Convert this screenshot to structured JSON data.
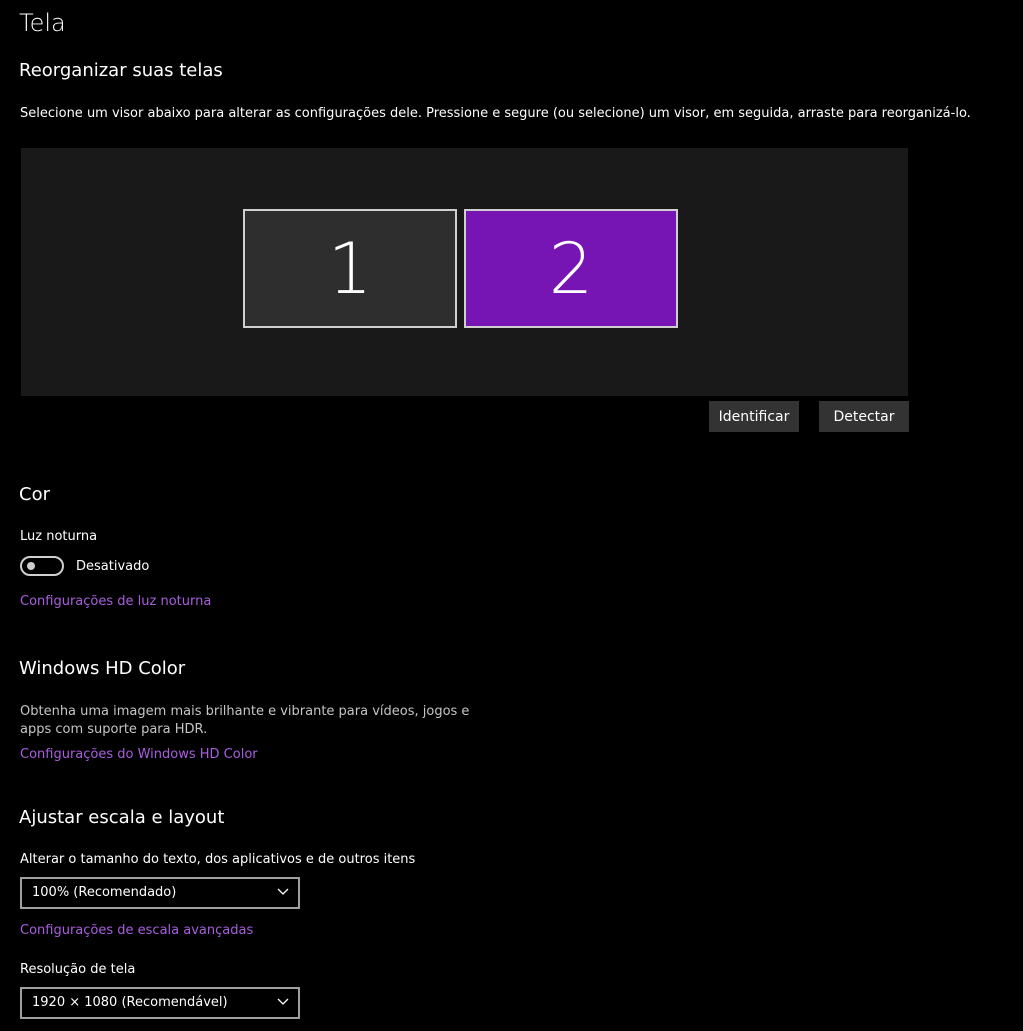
{
  "page": {
    "title": "Tela"
  },
  "arrange": {
    "heading": "Reorganizar suas telas",
    "description": "Selecione um visor abaixo para alterar as configurações dele. Pressione e segure (ou selecione) um visor, em seguida, arraste para reorganizá-lo.",
    "monitors": [
      {
        "label": "1",
        "selected": false
      },
      {
        "label": "2",
        "selected": true
      }
    ],
    "identify_label": "Identificar",
    "detect_label": "Detectar"
  },
  "color": {
    "heading": "Cor",
    "night_light_label": "Luz noturna",
    "night_light_state": "Desativado",
    "night_light_on": false,
    "night_light_settings_link": "Configurações de luz noturna"
  },
  "hd_color": {
    "heading": "Windows HD Color",
    "description_line1": "Obtenha uma imagem mais brilhante e vibrante para vídeos, jogos e",
    "description_line2": "apps com suporte para HDR.",
    "settings_link": "Configurações do Windows HD Color"
  },
  "scale_layout": {
    "heading": "Ajustar escala e layout",
    "scale_label": "Alterar o tamanho do texto, dos aplicativos e de outros itens",
    "scale_value": "100% (Recomendado)",
    "advanced_scale_link": "Configurações de escala avançadas",
    "resolution_label": "Resolução de tela",
    "resolution_value": "1920 × 1080 (Recomendável)"
  },
  "colors": {
    "accent": "#7614b4",
    "link": "#a95ede",
    "background": "#000000"
  }
}
